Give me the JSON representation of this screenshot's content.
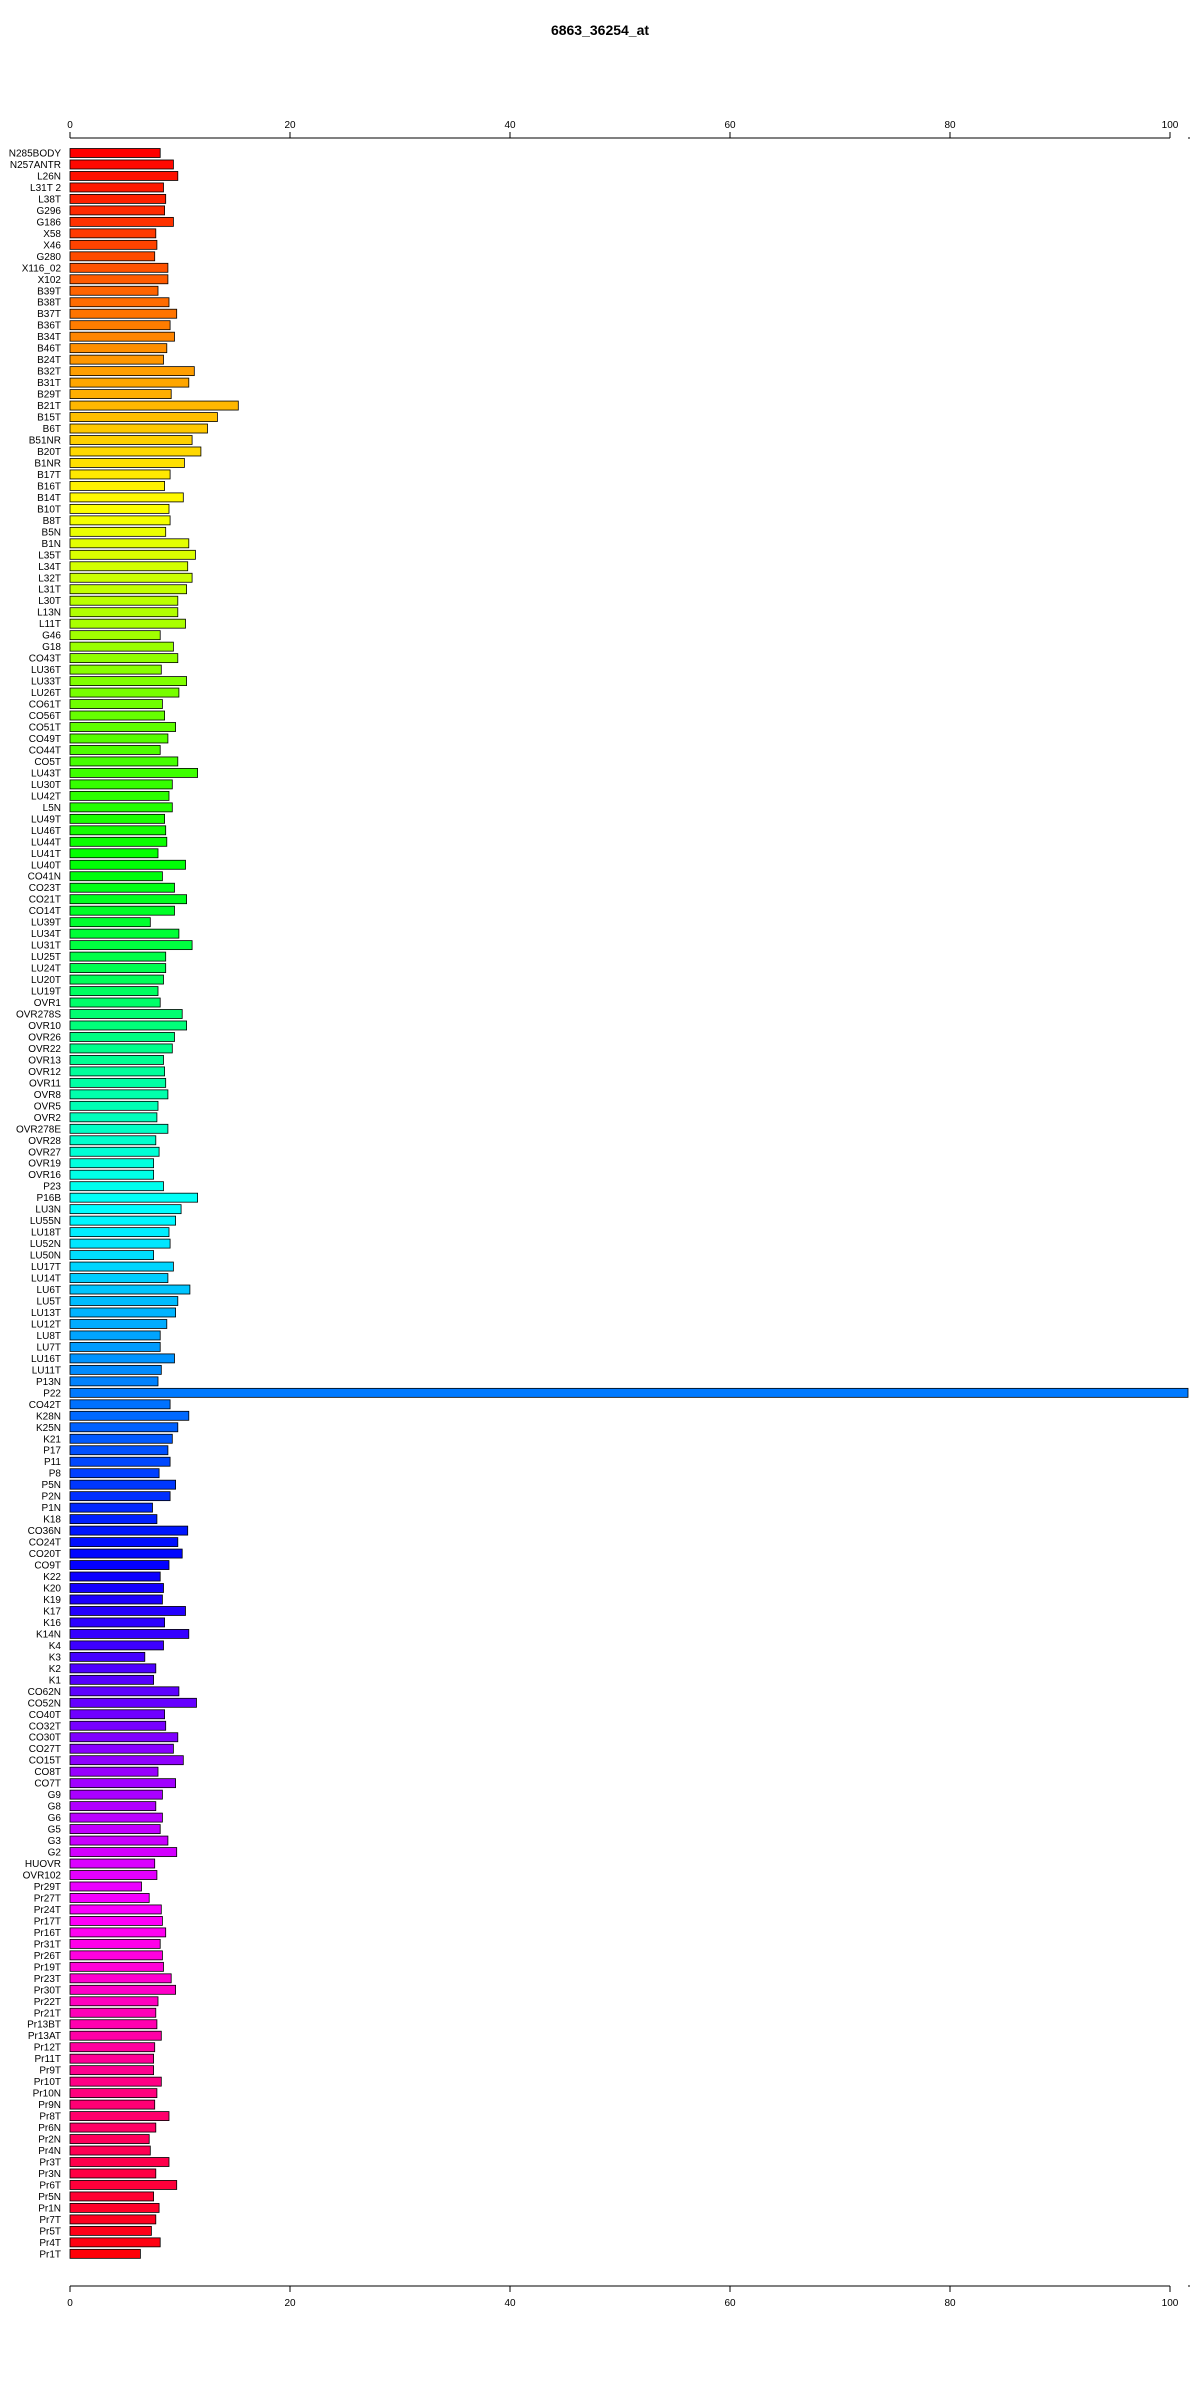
{
  "chart_data": {
    "type": "bar",
    "orientation": "horizontal",
    "title": "6863_36254_at",
    "xlabel": "",
    "ylabel": "",
    "xlim": [
      0,
      100
    ],
    "xticks": [
      0,
      20,
      40,
      60,
      80,
      100
    ],
    "grid": false,
    "legend": "none",
    "colors": "rainbow gradient (red → magenta → blue → cyan → green → yellow → orange → red)",
    "categories": [
      "N285BODY",
      "N257ANTR",
      "L26N",
      "L31T 2",
      "L38T",
      "G296",
      "G186",
      "X58",
      "X46",
      "G280",
      "X116_02",
      "X102",
      "B39T",
      "B38T",
      "B37T",
      "B36T",
      "B34T",
      "B46T",
      "B24T",
      "B32T",
      "B31T",
      "B29T",
      "B21T",
      "B15T",
      "B6T",
      "B51NR",
      "B20T",
      "B1NR",
      "B17T",
      "B16T",
      "B14T",
      "B10T",
      "B8T",
      "B5N",
      "B1N",
      "L35T",
      "L34T",
      "L32T",
      "L31T",
      "L30T",
      "L13N",
      "L11T",
      "G46",
      "G18",
      "CO43T",
      "LU36T",
      "LU33T",
      "LU26T",
      "CO61T",
      "CO56T",
      "CO51T",
      "CO49T",
      "CO44T",
      "CO5T",
      "LU43T",
      "LU30T",
      "LU42T",
      "L5N",
      "LU49T",
      "LU46T",
      "LU44T",
      "LU41T",
      "LU40T",
      "CO41N",
      "CO23T",
      "CO21T",
      "CO14T",
      "LU39T",
      "LU34T",
      "LU31T",
      "LU25T",
      "LU24T",
      "LU20T",
      "LU19T",
      "OVR1",
      "OVR278S",
      "OVR10",
      "OVR26",
      "OVR22",
      "OVR13",
      "OVR12",
      "OVR11",
      "OVR8",
      "OVR5",
      "OVR2",
      "OVR278E",
      "OVR28",
      "OVR27",
      "OVR19",
      "OVR16",
      "P23",
      "P16B",
      "LU3N",
      "LU55N",
      "LU18T",
      "LU52N",
      "LU50N",
      "LU17T",
      "LU14T",
      "LU6T",
      "LU5T",
      "LU13T",
      "LU12T",
      "LU8T",
      "LU7T",
      "LU16T",
      "LU11T",
      "P13N",
      "P22",
      "CO42T",
      "K28N",
      "K25N",
      "K21",
      "P17",
      "P11",
      "P8",
      "P5N",
      "P2N",
      "P1N",
      "K18",
      "CO36N",
      "CO24T",
      "CO20T",
      "CO9T",
      "K22",
      "K20",
      "K19",
      "K17",
      "K16",
      "K14N",
      "K4",
      "K3",
      "K2",
      "K1",
      "CO62N",
      "CO52N",
      "CO40T",
      "CO32T",
      "CO30T",
      "CO27T",
      "CO15T",
      "CO8T",
      "CO7T",
      "G9",
      "G8",
      "G6",
      "G5",
      "G3",
      "G2",
      "HUOVR",
      "OVR102",
      "Pr29T",
      "Pr27T",
      "Pr24T",
      "Pr17T",
      "Pr16T",
      "Pr31T",
      "Pr26T",
      "Pr19T",
      "Pr23T",
      "Pr30T",
      "Pr22T",
      "Pr21T",
      "Pr13BT",
      "Pr13AT",
      "Pr12T",
      "Pr11T",
      "Pr9T",
      "Pr10T",
      "Pr10N",
      "Pr9N",
      "Pr8T",
      "Pr6N",
      "Pr2N",
      "Pr4N",
      "Pr3T",
      "Pr3N",
      "Pr6T",
      "Pr5N",
      "Pr1N",
      "Pr7T",
      "Pr5T",
      "Pr4T",
      "Pr1T"
    ],
    "values": [
      8.2,
      9.4,
      9.8,
      8.5,
      8.7,
      8.6,
      9.4,
      7.8,
      7.9,
      7.7,
      8.9,
      8.9,
      8.0,
      9.0,
      9.7,
      9.1,
      9.5,
      8.8,
      8.5,
      11.3,
      10.8,
      9.2,
      15.3,
      13.4,
      12.5,
      11.1,
      11.9,
      10.4,
      9.1,
      8.6,
      10.3,
      9.0,
      9.1,
      8.7,
      10.8,
      11.4,
      10.7,
      11.1,
      10.6,
      9.8,
      9.8,
      10.5,
      8.2,
      9.4,
      9.8,
      8.3,
      10.6,
      9.9,
      8.4,
      8.6,
      9.6,
      8.9,
      8.2,
      9.8,
      11.6,
      9.3,
      9.0,
      9.3,
      8.6,
      8.7,
      8.8,
      8.0,
      10.5,
      8.4,
      9.5,
      10.6,
      9.5,
      7.3,
      9.9,
      11.1,
      8.7,
      8.7,
      8.5,
      8.0,
      8.2,
      10.2,
      10.6,
      9.5,
      9.3,
      8.5,
      8.6,
      8.7,
      8.9,
      8.0,
      7.9,
      8.9,
      7.8,
      8.1,
      7.6,
      7.6,
      8.5,
      11.6,
      10.1,
      9.6,
      9.0,
      9.1,
      7.6,
      9.4,
      8.9,
      10.9,
      9.8,
      9.6,
      8.8,
      8.2,
      8.2,
      9.5,
      8.3,
      8.0,
      101.8,
      9.1,
      10.8,
      9.8,
      9.3,
      8.9,
      9.1,
      8.1,
      9.6,
      9.1,
      7.5,
      7.9,
      10.7,
      9.8,
      10.2,
      9.0,
      8.2,
      8.5,
      8.4,
      10.5,
      8.6,
      10.8,
      8.5,
      6.8,
      7.8,
      7.6,
      9.9,
      11.5,
      8.6,
      8.7,
      9.8,
      9.4,
      10.3,
      8.0,
      9.6,
      8.4,
      7.8,
      8.4,
      8.2,
      8.9,
      9.7,
      7.7,
      7.9,
      6.5,
      7.2,
      8.3,
      8.4,
      8.7,
      8.2,
      8.4,
      8.5,
      9.2,
      9.6,
      8.0,
      7.8,
      7.9,
      8.3,
      7.7,
      7.6,
      7.6,
      8.3,
      7.9,
      7.7,
      9.0,
      7.8,
      7.2,
      7.3,
      9.0,
      7.8,
      9.7,
      7.6,
      8.1,
      7.8,
      7.4,
      8.2,
      6.4
    ]
  }
}
